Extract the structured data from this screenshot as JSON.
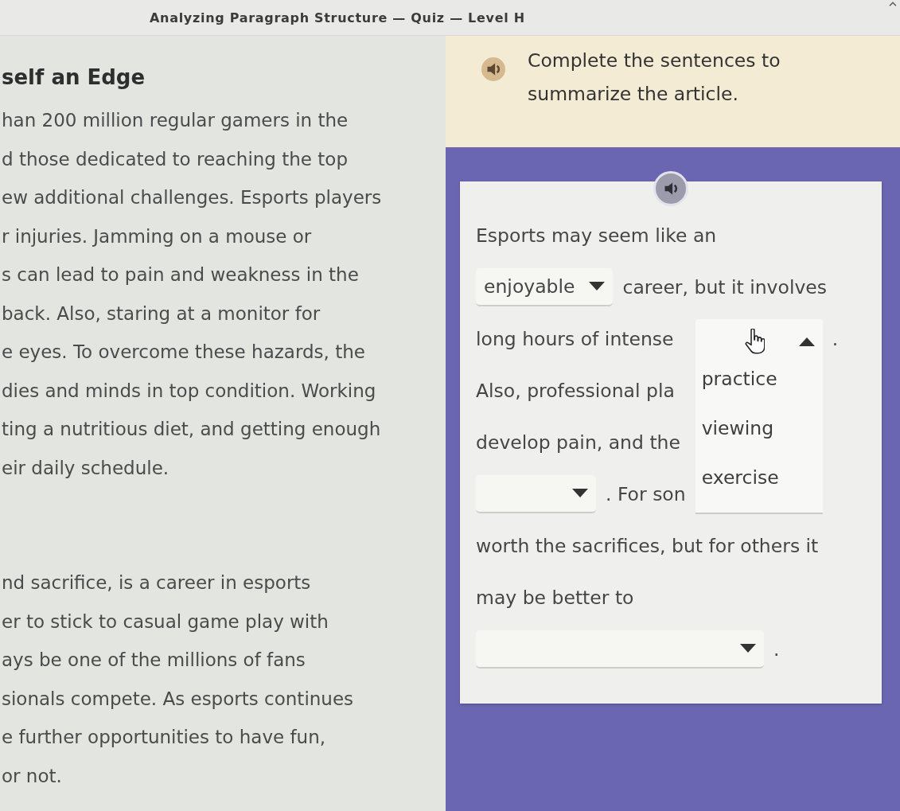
{
  "title": "Analyzing Paragraph Structure — Quiz — Level H",
  "article": {
    "heading": "self an Edge",
    "paragraphs": [
      {
        "lines": [
          "han 200 million regular gamers in the",
          "d those dedicated to reaching the top",
          "ew additional challenges. Esports players",
          "r injuries. Jamming on a mouse or",
          "s can lead to pain and weakness in the",
          "back. Also, staring at a monitor for",
          "e eyes. To overcome these hazards, the",
          "dies and minds in top condition. Working",
          "ting a nutritious diet, and getting enough",
          "eir daily schedule."
        ]
      },
      {
        "lines": [
          "nd sacrifice, is a career in esports",
          "er to stick to casual game play with",
          "ays be one of the millions of fans",
          "sionals compete. As esports continues",
          "e further opportunities to have fun,",
          "or not."
        ]
      }
    ]
  },
  "instructions": {
    "text": "Complete the sentences to summarize the article."
  },
  "summary": {
    "lines": [
      {
        "segments": [
          {
            "kind": "text",
            "text": "Esports may seem like an"
          }
        ]
      },
      {
        "segments": [
          {
            "kind": "dropdown",
            "value": "enjoyable",
            "expanded": false
          },
          {
            "kind": "text",
            "text": "career, but it involves"
          }
        ]
      },
      {
        "segments": [
          {
            "kind": "text",
            "text": "long hours of intense"
          },
          {
            "kind": "dropdown",
            "expanded": true,
            "options": [
              {
                "label": "practice",
                "selected": false
              },
              {
                "label": "viewing",
                "selected": false
              },
              {
                "label": "exercise",
                "selected": false
              }
            ]
          },
          {
            "kind": "text",
            "text": "."
          }
        ]
      },
      {
        "segments": [
          {
            "kind": "text",
            "text": "Also, professional pla"
          }
        ]
      },
      {
        "segments": [
          {
            "kind": "text",
            "text": "develop pain, and the"
          }
        ]
      },
      {
        "segments": [
          {
            "kind": "dropdown",
            "expanded": false
          },
          {
            "kind": "text",
            "text": ". For son"
          }
        ]
      },
      {
        "segments": [
          {
            "kind": "text",
            "text": "worth the sacrifices, but for others it"
          }
        ]
      },
      {
        "segments": [
          {
            "kind": "text",
            "text": "may be better to"
          }
        ]
      },
      {
        "segments": [
          {
            "kind": "dropdown",
            "expanded": false
          },
          {
            "kind": "text",
            "text": "."
          }
        ]
      }
    ]
  }
}
